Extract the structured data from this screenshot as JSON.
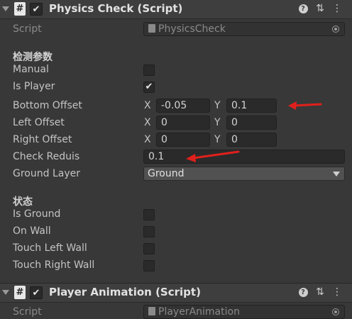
{
  "component1": {
    "title": "Physics Check (Script)",
    "script_label": "Script",
    "script_value": "PhysicsCheck",
    "section1_title": "检测参数",
    "manual_label": "Manual",
    "manual_checked": false,
    "is_player_label": "Is Player",
    "is_player_checked": true,
    "bottom_offset_label": "Bottom Offset",
    "bottom_offset": {
      "x_label": "X",
      "x": "-0.05",
      "y_label": "Y",
      "y": "0.1"
    },
    "left_offset_label": "Left Offset",
    "left_offset": {
      "x_label": "X",
      "x": "0",
      "y_label": "Y",
      "y": "0"
    },
    "right_offset_label": "Right Offset",
    "right_offset": {
      "x_label": "X",
      "x": "0",
      "y_label": "Y",
      "y": "0"
    },
    "check_radius_label": "Check Reduis",
    "check_radius": "0.1",
    "ground_layer_label": "Ground Layer",
    "ground_layer_value": "Ground",
    "section2_title": "状态",
    "is_ground_label": "Is Ground",
    "on_wall_label": "On Wall",
    "touch_left_wall_label": "Touch Left Wall",
    "touch_right_wall_label": "Touch Right Wall"
  },
  "component2": {
    "title": "Player Animation (Script)",
    "script_label": "Script",
    "script_value": "PlayerAnimation"
  },
  "colors": {
    "background": "#383838",
    "header": "#3e3e3e",
    "field": "#2a2a2a",
    "annotation_arrow": "#e0201c"
  },
  "icons": {
    "script": "script-hash-icon",
    "help": "help-icon",
    "presets": "presets-sliders-icon",
    "menu": "kebab-menu-icon",
    "foldout": "foldout-triangle-icon",
    "object_picker": "object-picker-icon",
    "checkmark": "checkmark-icon",
    "dropdown": "dropdown-caret-icon",
    "annotation": "red-arrow-icon"
  }
}
